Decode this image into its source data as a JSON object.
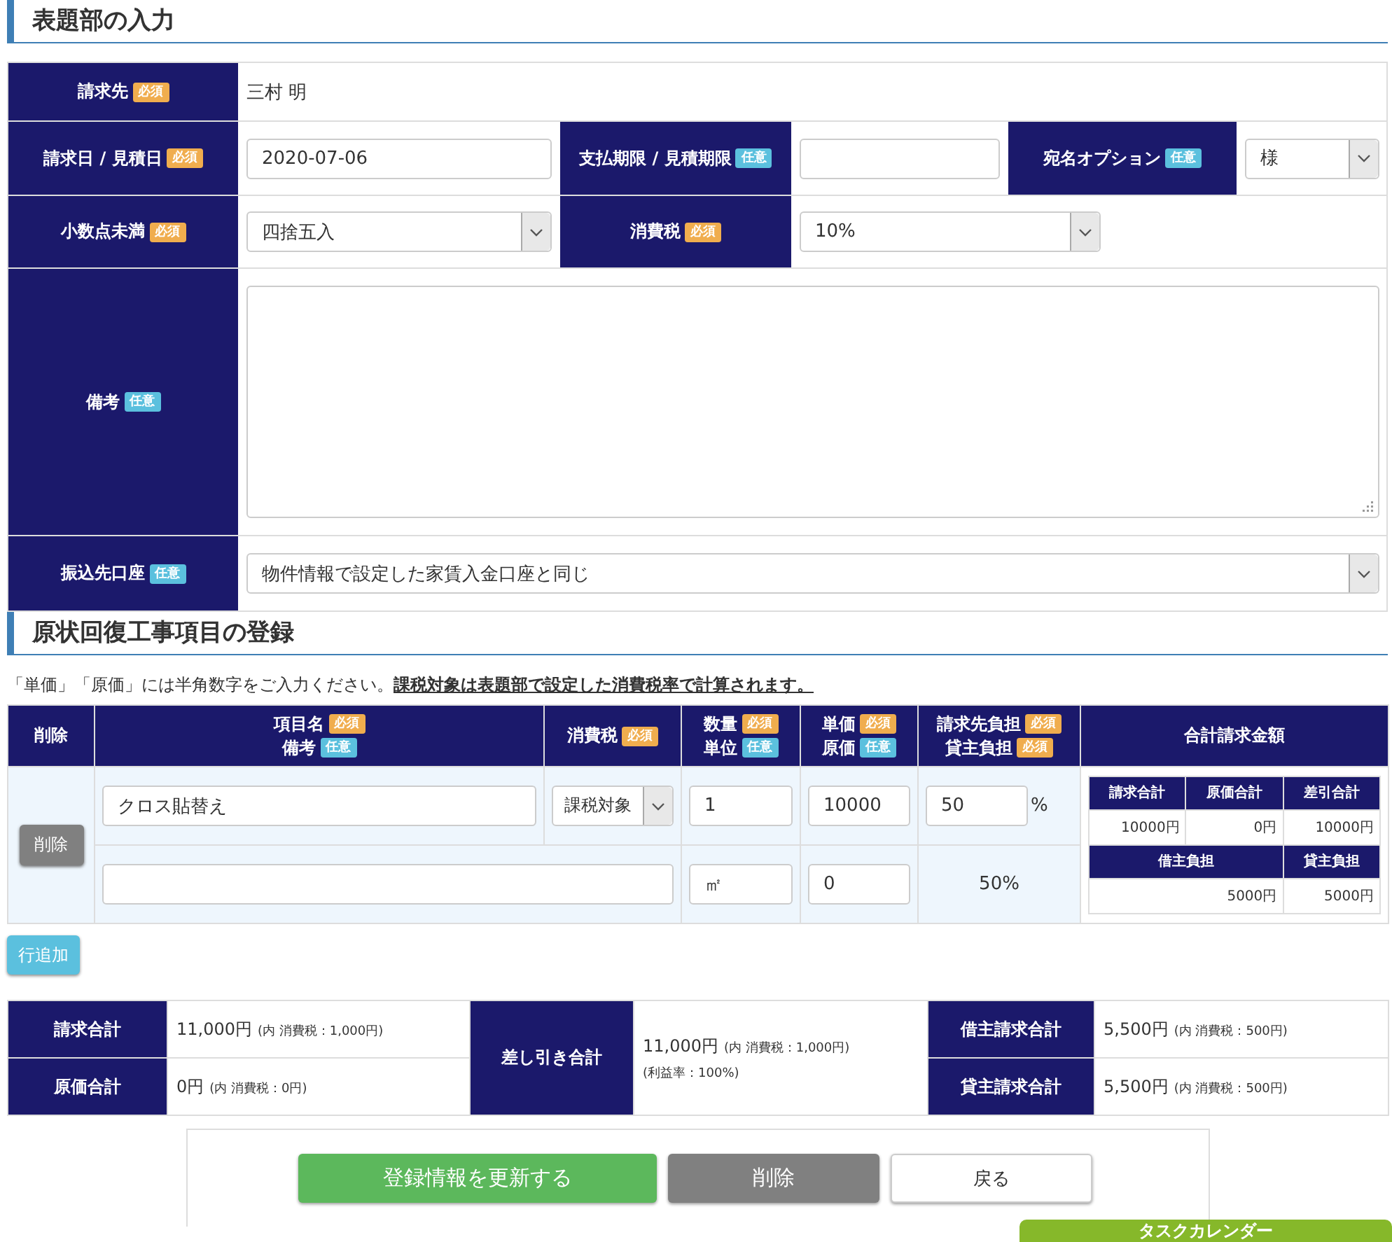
{
  "header_section": {
    "title": "表題部の入力",
    "rows": [
      {
        "cells": [
          {
            "kind": "label",
            "text": "請求先",
            "badge": {
              "text": "必須",
              "kind": "required"
            }
          },
          {
            "kind": "text",
            "value": "三村 明"
          }
        ]
      },
      {
        "cells": [
          {
            "kind": "label",
            "text": "請求日 / 見積日",
            "badge": {
              "text": "必須",
              "kind": "required"
            }
          },
          {
            "kind": "input",
            "value": "2020-07-06"
          },
          {
            "kind": "label",
            "text": "支払期限 / 見積期限",
            "badge": {
              "text": "任意",
              "kind": "optional"
            }
          },
          {
            "kind": "input"
          },
          {
            "kind": "label",
            "text": "宛名オプション",
            "badge": {
              "text": "任意",
              "kind": "optional"
            }
          },
          {
            "kind": "select",
            "value": "様"
          }
        ]
      },
      {
        "cells": [
          {
            "kind": "label",
            "text": "小数点未満",
            "badge": {
              "text": "必須",
              "kind": "required"
            }
          },
          {
            "kind": "select",
            "value": "四捨五入"
          },
          {
            "kind": "label",
            "text": "消費税",
            "badge": {
              "text": "必須",
              "kind": "required"
            }
          },
          {
            "kind": "select",
            "value": "10%"
          }
        ]
      },
      {
        "cells": [
          {
            "kind": "label",
            "text": "備考",
            "badge": {
              "text": "任意",
              "kind": "optional"
            }
          },
          {
            "kind": "textarea"
          }
        ]
      },
      {
        "cells": [
          {
            "kind": "label",
            "text": "振込先口座",
            "badge": {
              "text": "任意",
              "kind": "optional"
            }
          },
          {
            "kind": "select",
            "value": "物件情報で設定した家賃入金口座と同じ"
          }
        ]
      }
    ]
  },
  "items_section": {
    "title": "原状回復工事項目の登録",
    "note": "「単価」「原価」には半角数字をご入力ください。**課税対象は表題部で設定した消費税率で計算されます。**",
    "columns": [
      {
        "lines": [
          {
            "text": "削除"
          }
        ]
      },
      {
        "lines": [
          {
            "text": "項目名",
            "badge": {
              "text": "必須",
              "kind": "required"
            }
          },
          {
            "text": "備考",
            "badge": {
              "text": "任意",
              "kind": "optional"
            }
          }
        ]
      },
      {
        "lines": [
          {
            "text": "消費税",
            "badge": {
              "text": "必須",
              "kind": "required"
            }
          }
        ]
      },
      {
        "lines": [
          {
            "text": "数量",
            "badge": {
              "text": "必須",
              "kind": "required"
            }
          },
          {
            "text": "単位",
            "badge": {
              "text": "任意",
              "kind": "optional"
            }
          }
        ]
      },
      {
        "lines": [
          {
            "text": "単価",
            "badge": {
              "text": "必須",
              "kind": "required"
            }
          },
          {
            "text": "原価",
            "badge": {
              "text": "任意",
              "kind": "optional"
            }
          }
        ]
      },
      {
        "lines": [
          {
            "text": "請求先負担",
            "badge": {
              "text": "必須",
              "kind": "required"
            }
          },
          {
            "text": "貸主負担",
            "badge": {
              "text": "必須",
              "kind": "required"
            }
          }
        ]
      },
      {
        "lines": [
          {
            "text": "合計請求金額"
          }
        ]
      }
    ],
    "rows": [
      {
        "delete_label": "削除",
        "name": "クロス貼替え",
        "tax": "課税対象",
        "quantity": "1",
        "unit": "㎡",
        "unit_price": "10000",
        "cost": "0",
        "client_share": "50",
        "percent_sign": "%",
        "owner_share": "50%",
        "summary": {
          "headers": [
            "請求合計",
            "原価合計",
            "差引合計"
          ],
          "values": [
            "10000円",
            "0円",
            "10000円"
          ],
          "share_headers": [
            "借主負担",
            "貸主負担"
          ],
          "share_values": [
            "5000円",
            "5000円"
          ]
        }
      }
    ],
    "add_row_label": "行追加"
  },
  "totals": {
    "left": [
      {
        "label": "請求合計",
        "amount": "11,000円",
        "note": "(内 消費税：1,000円)"
      },
      {
        "label": "原価合計",
        "amount": "0円",
        "note": "(内 消費税：0円)"
      }
    ],
    "middle": {
      "label": "差し引き合計",
      "amount": "11,000円",
      "note": "(内 消費税：1,000円)",
      "extra": "(利益率：100%)"
    },
    "right": [
      {
        "label": "借主請求合計",
        "amount": "5,500円",
        "note": "(内 消費税：500円)"
      },
      {
        "label": "貸主請求合計",
        "amount": "5,500円",
        "note": "(内 消費税：500円)"
      }
    ]
  },
  "actions": [
    {
      "label": "登録情報を更新する",
      "kind": "primary"
    },
    {
      "label": "削除",
      "kind": "danger"
    },
    {
      "label": "戻る",
      "kind": "default"
    }
  ],
  "float_tab": {
    "label": "タスクカレンダー"
  }
}
